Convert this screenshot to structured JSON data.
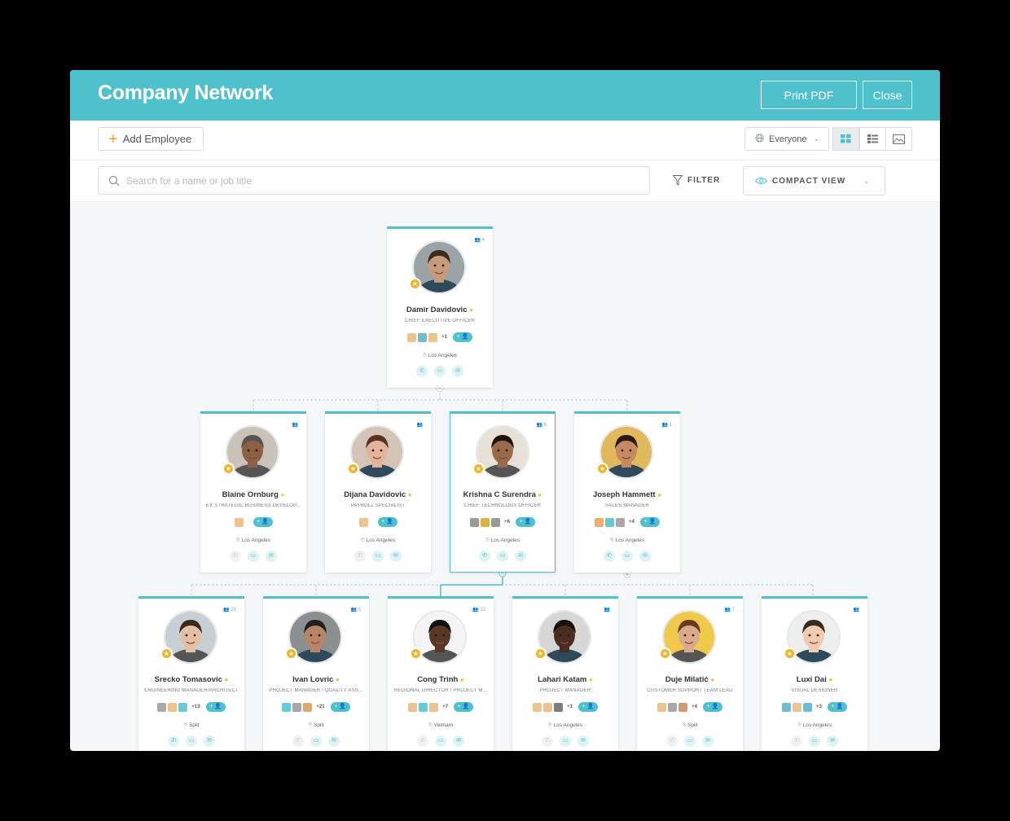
{
  "header": {
    "title": "Company Network",
    "print_label": "Print PDF",
    "close_label": "Close"
  },
  "toolbar": {
    "add_employee_label": "Add Employee",
    "audience_label": "Everyone",
    "views": [
      "grid-view",
      "list-view",
      "image-view"
    ]
  },
  "search": {
    "placeholder": "Search for a name or job title",
    "filter_label": "FILTER",
    "view_mode_label": "COMPACT VIEW"
  },
  "colors": {
    "accent": "#4ec1cc",
    "star": "#f0b429"
  },
  "employees": [
    {
      "name": "Damir Davidovic",
      "title": "CHIEF EXECUTIVE OFFICER",
      "location": "Los Angeles",
      "reports": "4",
      "badges_more": "+1"
    },
    {
      "name": "Blaine Ornburg",
      "title": "EX STRATEGIC BUSINESS DEVELOP...",
      "location": "Los Angeles",
      "reports": "",
      "badges_more": ""
    },
    {
      "name": "Dijana Davidovic",
      "title": "PAYROLL SPECIALIST",
      "location": "Los Angeles",
      "reports": "",
      "badges_more": ""
    },
    {
      "name": "Krishna C Surendra",
      "title": "CHIEF TECHNOLOGY OFFICER",
      "location": "Los Angeles",
      "reports": "6",
      "badges_more": "+6"
    },
    {
      "name": "Joseph Hammett",
      "title": "SALES MANAGER",
      "location": "Los Angeles",
      "reports": "1",
      "badges_more": "+4"
    },
    {
      "name": "Srecko Tomasovic",
      "title": "ENGINEERING MANAGER/ARCHITECT",
      "location": "Split",
      "reports": "20",
      "badges_more": "+13"
    },
    {
      "name": "Ivan Lovric",
      "title": "PROJECT MANAGER / QUALITY ASS...",
      "location": "Split",
      "reports": "5",
      "badges_more": "+21"
    },
    {
      "name": "Cong Trinh",
      "title": "REGIONAL DIRECTOR / PROJECT M...",
      "location": "Vietnam",
      "reports": "12",
      "badges_more": "+7"
    },
    {
      "name": "Lahari Katam",
      "title": "PROJECT MANAGER",
      "location": "Los Angeles",
      "reports": "",
      "badges_more": "+1"
    },
    {
      "name": "Duje Milatić",
      "title": "CUSTOMER SUPPORT TEAM LEAD",
      "location": "Split",
      "reports": "7",
      "badges_more": "+4"
    },
    {
      "name": "Luxi Dai",
      "title": "VISUAL DESIGNER",
      "location": "Los Angeles",
      "reports": "",
      "badges_more": "+3"
    }
  ]
}
